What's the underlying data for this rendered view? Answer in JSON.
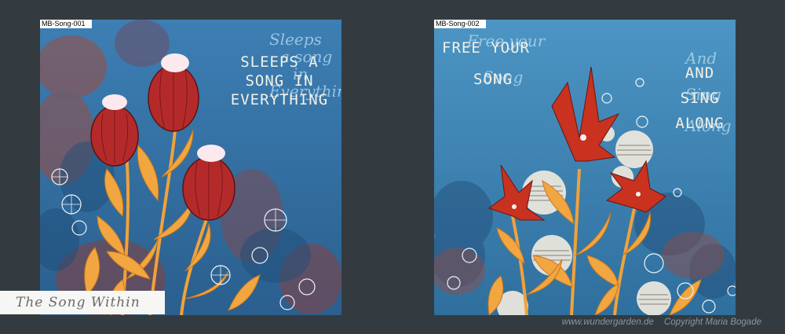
{
  "artworks": [
    {
      "tag": "MB-Song-001",
      "text_lines": [
        "SLEEPS A",
        "SONG IN",
        "EVERYTHING"
      ],
      "script_lines": [
        "Sleeps",
        "a song",
        "in",
        "Everything"
      ],
      "colors": {
        "bg_top": "#3d7fb4",
        "bg_bottom": "#2a5f8e",
        "bloom": "#b42a2a",
        "leaf": "#f2a640"
      }
    },
    {
      "tag": "MB-Song-002",
      "text_lines_left": [
        "FREE YOUR",
        "SONG"
      ],
      "script_lines_left": [
        "Free your",
        "Song"
      ],
      "text_lines_right": [
        "AND",
        "SING",
        "ALONG"
      ],
      "script_lines_right": [
        "And",
        "Sing",
        "Along"
      ],
      "colors": {
        "bg_top": "#4c95c4",
        "bg_bottom": "#2f6f9e",
        "bloom": "#c8321f",
        "leaf": "#f2a640"
      }
    }
  ],
  "title_label": "The Song Within",
  "footer": {
    "website": "www.wundergarden.de",
    "copyright": "Copyright Maria Bogade"
  }
}
